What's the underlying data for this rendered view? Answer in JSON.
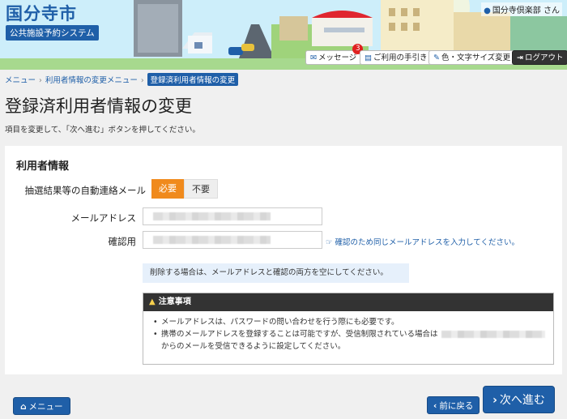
{
  "header": {
    "logo_title": "国分寺市",
    "logo_subtitle": "公共施設予約システム",
    "user_name": "国分寺倶楽部 さん",
    "buttons": {
      "message": "メッセージ",
      "message_count": "3",
      "guide": "ご利用の手引き",
      "display": "色・文字サイズ変更",
      "logout": "ログアウト"
    }
  },
  "breadcrumb": {
    "items": [
      "メニュー",
      "利用者情報の変更メニュー"
    ],
    "current": "登録済利用者情報の変更"
  },
  "page": {
    "title": "登録済利用者情報の変更",
    "instruction": "項目を変更して、「次へ進む」ボタンを押してください。"
  },
  "form": {
    "section_title": "利用者情報",
    "auto_mail_label": "抽選結果等の自動連絡メール",
    "auto_mail_options": [
      "必要",
      "不要"
    ],
    "auto_mail_selected": "必要",
    "email_label": "メールアドレス",
    "confirm_label": "確認用",
    "confirm_hint": "確認のため同じメールアドレスを入力してください。",
    "delete_info": "削除する場合は、メールアドレスと確認の両方を空にしてください。"
  },
  "notice": {
    "title": "注意事項",
    "items": [
      "メールアドレスは、パスワードの問い合わせを行う際にも必要です。",
      "携帯のメールアドレスを登録することは可能ですが、受信制限されている場合は",
      "からのメールを受信できるように設定してください。"
    ]
  },
  "footer": {
    "menu": "メニュー",
    "back": "前に戻る",
    "next": "次へ進む"
  },
  "colors": {
    "primary": "#1f5fa8",
    "accent": "#f08a1c",
    "dark": "#333333"
  }
}
